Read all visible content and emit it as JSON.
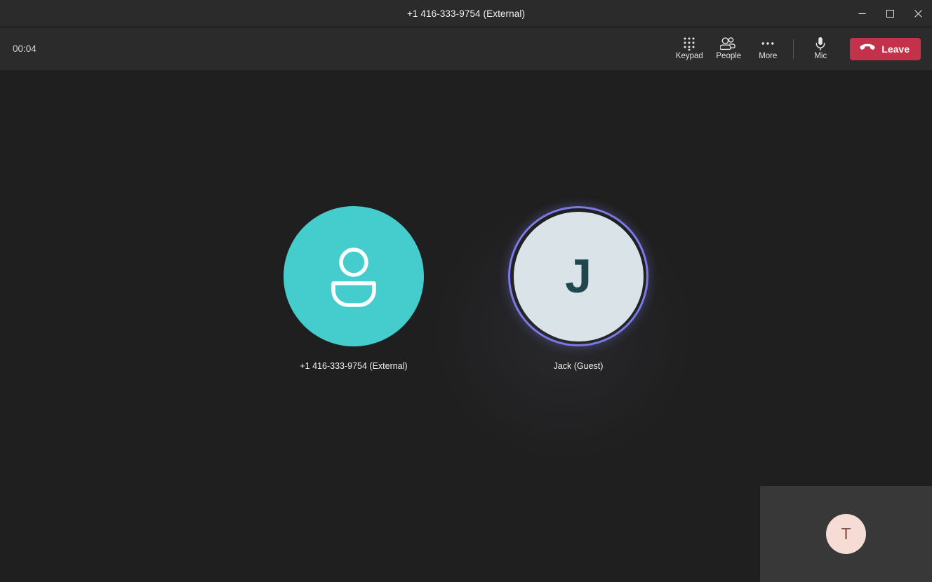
{
  "window": {
    "title": "+1 416-333-9754 (External)",
    "controls": [
      {
        "name": "minimize",
        "icon": "minimize-icon"
      },
      {
        "name": "maximize",
        "icon": "maximize-icon"
      },
      {
        "name": "close",
        "icon": "close-icon"
      }
    ]
  },
  "toolbar": {
    "timer": "00:04",
    "actions": [
      {
        "label": "Keypad",
        "icon": "keypad-icon"
      },
      {
        "label": "People",
        "icon": "people-icon"
      },
      {
        "label": "More",
        "icon": "more-icon"
      }
    ],
    "mic": {
      "label": "Mic",
      "icon": "mic-icon"
    },
    "leave": {
      "label": "Leave",
      "icon": "hangup-icon",
      "color": "#c4314b"
    }
  },
  "stage": {
    "participants": [
      {
        "name": "+1 416-333-9754 (External)",
        "avatar_type": "person-glyph",
        "avatar_color": "#45cdcd",
        "speaking": false
      },
      {
        "name": "Jack (Guest)",
        "avatar_type": "initials",
        "initials": "J",
        "avatar_color": "#dae3e8",
        "initials_color": "#20474d",
        "speaking": true,
        "speaking_ring_color": "#7a7ae8"
      }
    ]
  },
  "self_view": {
    "initials": "T",
    "avatar_color": "#f7dcd5",
    "initials_color": "#8b4a3e"
  }
}
